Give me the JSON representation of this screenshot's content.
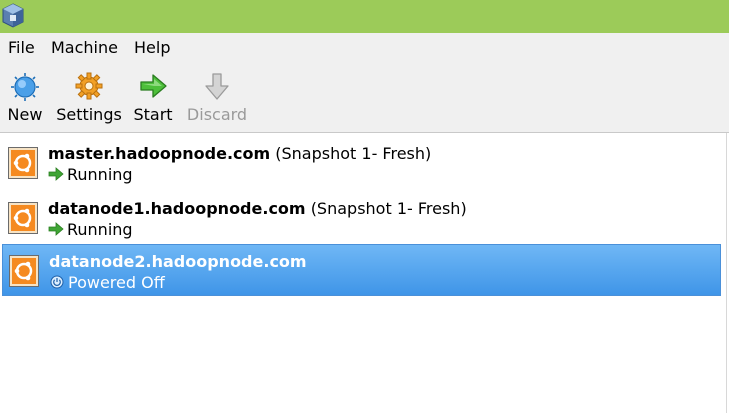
{
  "menu": {
    "items": [
      {
        "label": "File"
      },
      {
        "label": "Machine"
      },
      {
        "label": "Help"
      }
    ]
  },
  "toolbar": {
    "new_label": "New",
    "new_icon": "new-machine-icon",
    "settings_label": "Settings",
    "settings_icon": "gear-icon",
    "start_label": "Start",
    "start_icon": "start-arrow-icon",
    "discard_label": "Discard",
    "discard_icon": "discard-arrow-icon",
    "discard_enabled": false
  },
  "colors": {
    "titlebar": "#9ccb59",
    "selection": "#3f95e8",
    "running_arrow": "#3fa535",
    "disabled_text": "#9a9a9a"
  },
  "vms": [
    {
      "name": "master.hadoopnode.com",
      "snapshot": "(Snapshot 1- Fresh)",
      "status": "Running",
      "status_icon": "running-arrow-icon",
      "selected": false
    },
    {
      "name": "datanode1.hadoopnode.com",
      "snapshot": "(Snapshot 1- Fresh)",
      "status": "Running",
      "status_icon": "running-arrow-icon",
      "selected": false
    },
    {
      "name": "datanode2.hadoopnode.com",
      "snapshot": "",
      "status": "Powered Off",
      "status_icon": "power-off-icon",
      "selected": true
    }
  ]
}
